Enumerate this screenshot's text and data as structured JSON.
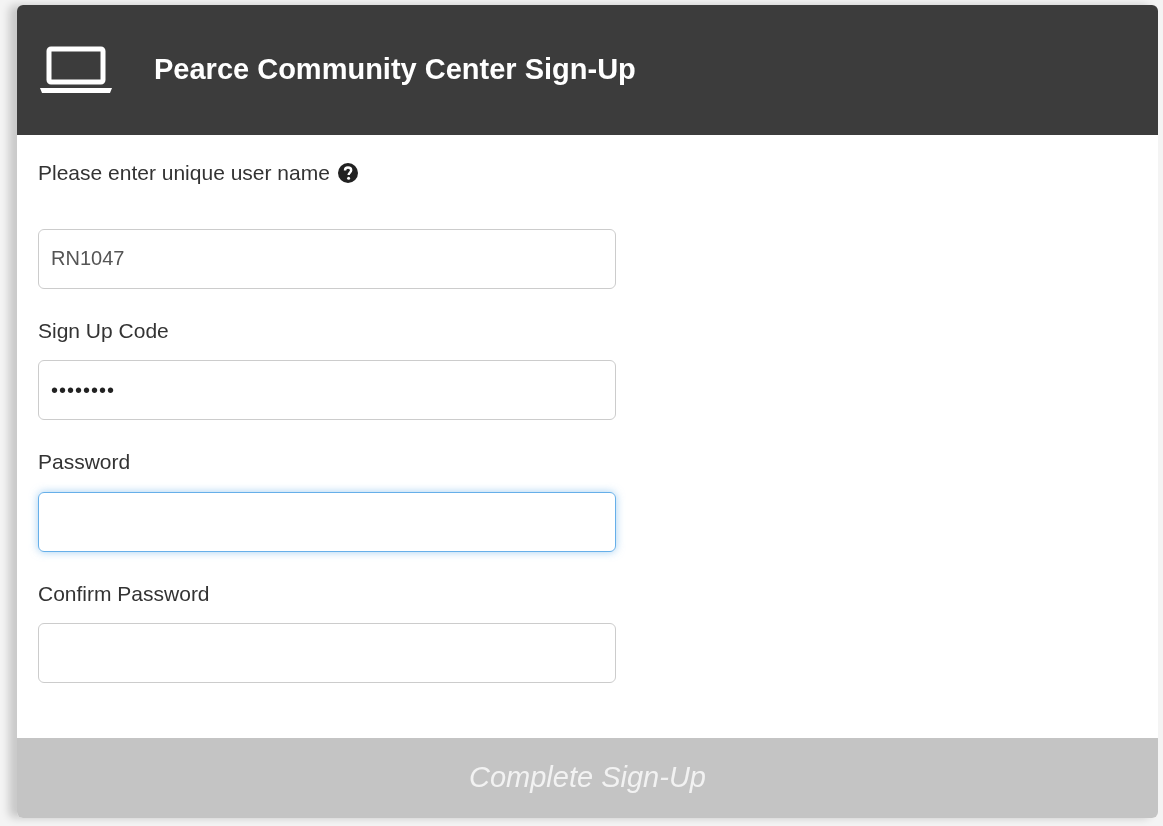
{
  "header": {
    "title": "Pearce Community Center Sign-Up"
  },
  "fields": [
    {
      "label": "Please enter unique user name",
      "help": true,
      "value": "RN1047",
      "focused": false,
      "kind": "text"
    },
    {
      "label": "Sign Up Code",
      "help": false,
      "value": "••••••••",
      "focused": false,
      "kind": "password"
    },
    {
      "label": "Password",
      "help": false,
      "focused": true,
      "kind": "password"
    },
    {
      "label": "Confirm Password",
      "help": false,
      "focused": false,
      "kind": "password"
    }
  ],
  "submit": {
    "label": "Complete Sign-Up",
    "disabled": true
  }
}
